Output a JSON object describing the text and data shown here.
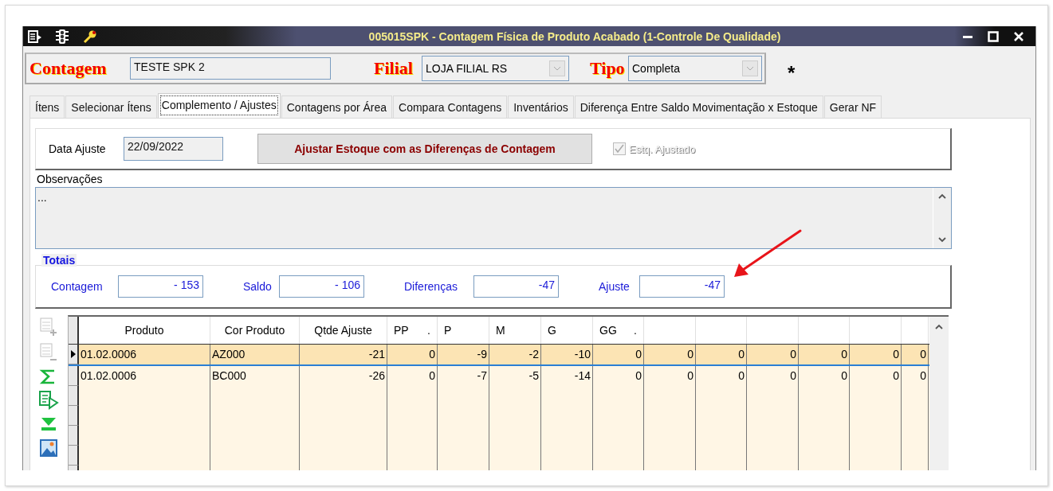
{
  "window": {
    "title": "005015SPK - Contagem Física de Produto Acabado (1-Controle De Qualidade)"
  },
  "header": {
    "contagem_label": "Contagem",
    "contagem_value": "TESTE SPK 2",
    "filial_label": "Filial",
    "filial_value": "LOJA FILIAL RS",
    "tipo_label": "Tipo",
    "tipo_value": "Completa",
    "modified_mark": "*"
  },
  "tabs": [
    {
      "label": "Ítens",
      "selected": false
    },
    {
      "label": "Selecionar Ítens",
      "selected": false
    },
    {
      "label": "Complemento / Ajustes",
      "selected": true
    },
    {
      "label": "Contagens por Área",
      "selected": false
    },
    {
      "label": "Compara Contagens",
      "selected": false
    },
    {
      "label": "Inventários",
      "selected": false
    },
    {
      "label": "Diferença Entre Saldo Movimentação x Estoque",
      "selected": false
    },
    {
      "label": "Gerar NF",
      "selected": false
    }
  ],
  "adjust": {
    "date_label": "Data Ajuste",
    "date_value": "22/09/2022",
    "button": "Ajustar Estoque com as Diferenças de Contagem",
    "checkbox": {
      "label": "Estq. Ajustado",
      "checked": true,
      "disabled": true
    }
  },
  "observacoes": {
    "label": "Observações",
    "value": "..."
  },
  "totais": {
    "title": "Totais",
    "fields": [
      {
        "label": "Contagem",
        "value": "- 153"
      },
      {
        "label": "Saldo",
        "value": "- 106"
      },
      {
        "label": "Diferenças",
        "value": "-47"
      },
      {
        "label": "Ajuste",
        "value": "-47"
      }
    ]
  },
  "grid_toolbar": [
    {
      "kind": "add-row",
      "disabled": true
    },
    {
      "kind": "remove-row",
      "disabled": true
    },
    {
      "kind": "sum",
      "disabled": false
    },
    {
      "kind": "export",
      "disabled": false
    },
    {
      "kind": "move-last",
      "disabled": false
    },
    {
      "kind": "image",
      "disabled": false
    }
  ],
  "table": {
    "columns": [
      {
        "label": "Produto"
      },
      {
        "label": "Cor Produto"
      },
      {
        "label": "Qtde Ajuste"
      },
      {
        "label": "PP",
        "suffix": "."
      },
      {
        "label": "P"
      },
      {
        "label": "M"
      },
      {
        "label": "G"
      },
      {
        "label": "GG",
        "suffix": "."
      }
    ],
    "rows": [
      {
        "selected": true,
        "cells": [
          "01.02.0006",
          "AZ000",
          "-21",
          "0",
          "-9",
          "-2",
          "-10",
          "0",
          "0",
          "0",
          "0",
          "0",
          "0",
          "0"
        ]
      },
      {
        "selected": false,
        "cells": [
          "01.02.0006",
          "BC000",
          "-26",
          "0",
          "-7",
          "-5",
          "-14",
          "0",
          "0",
          "0",
          "0",
          "0",
          "0",
          "0"
        ]
      }
    ]
  }
}
